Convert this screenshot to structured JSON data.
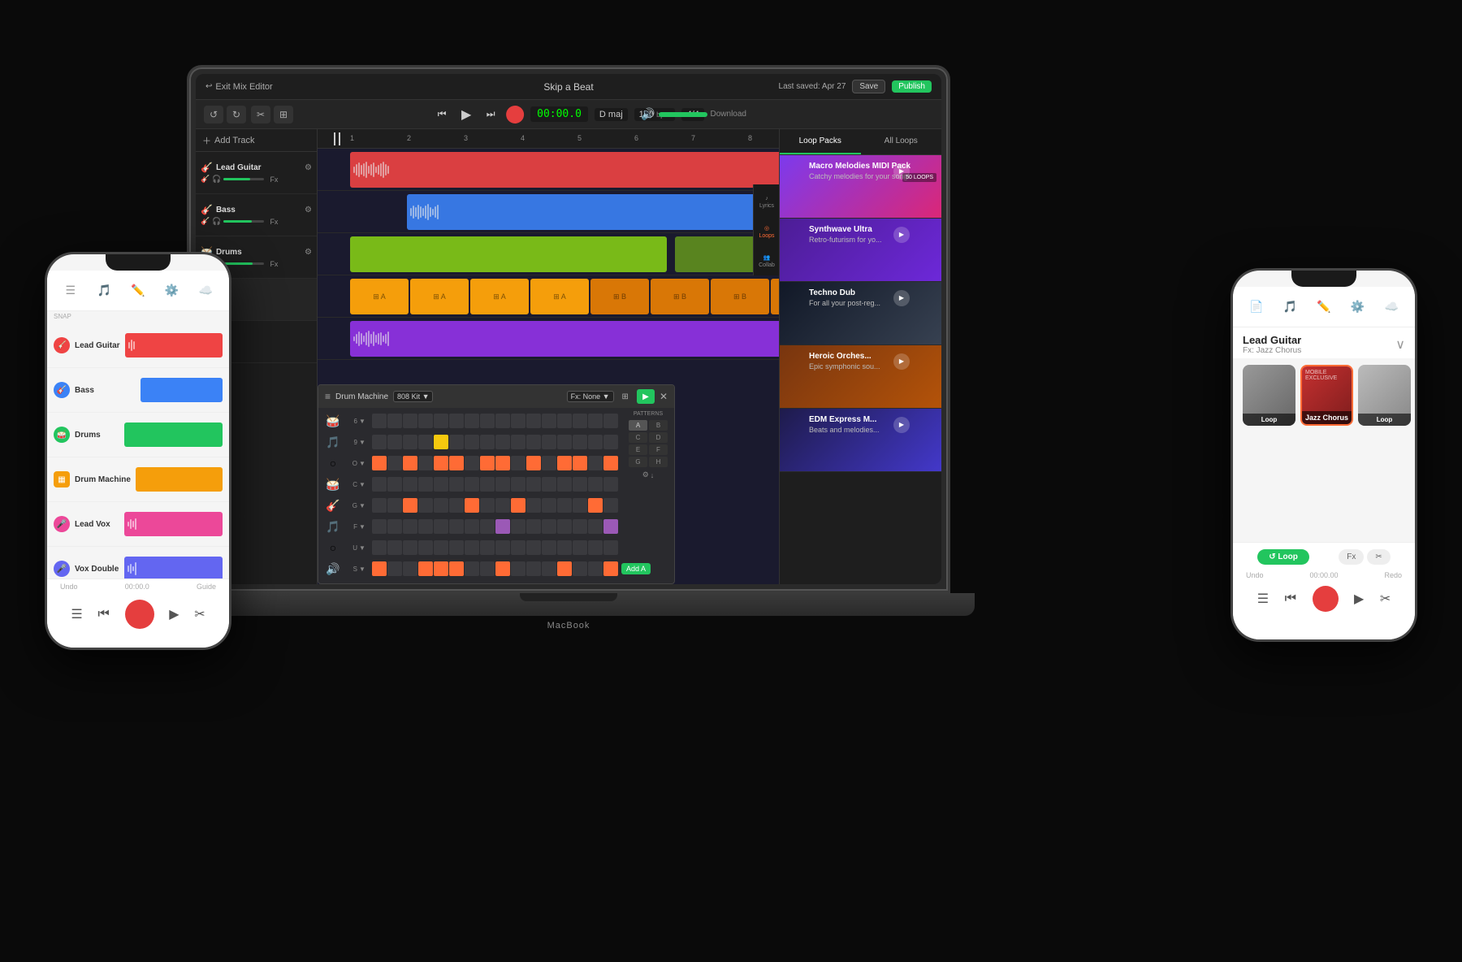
{
  "scene": {
    "background": "#0a0a0a"
  },
  "laptop": {
    "macbook_label": "MacBook",
    "daw": {
      "title": "Skip a Beat",
      "exit_label": "Exit Mix Editor",
      "last_saved": "Last saved: Apr 27",
      "save_label": "Save",
      "publish_label": "Publish",
      "download_label": "Download",
      "time": "00:00.0",
      "key": "D maj",
      "bpm": "120",
      "bpm_suffix": "bpm",
      "time_sig": "4/4",
      "tracks": [
        {
          "name": "Lead Guitar",
          "color": "#ef4444",
          "fx": "Fx"
        },
        {
          "name": "Bass",
          "color": "#3b82f6",
          "fx": "Fx"
        },
        {
          "name": "Drums",
          "color": "#84cc16",
          "fx": "Fx"
        },
        {
          "name": "Drum Machine",
          "color": "#f59e0b",
          "fx": "Fx"
        },
        {
          "name": "Lead Vox",
          "color": "#ec4899",
          "fx": "Fx"
        }
      ],
      "sidenav": [
        {
          "icon": "♪",
          "label": "Lyrics"
        },
        {
          "icon": "◎",
          "label": "Loops"
        },
        {
          "icon": "👥",
          "label": "Collab"
        }
      ],
      "loops_panel": {
        "tab1": "Loop Packs",
        "tab2": "All Loops",
        "items": [
          {
            "title": "Macro Melodies MIDI Pack",
            "sub": "Catchy melodies for your song!",
            "count": "50 LOOPS",
            "bg": "#9333ea"
          },
          {
            "title": "Synthwave Ultra",
            "sub": "Retro-futurism for yo...",
            "count": "",
            "bg": "#7c3aed"
          },
          {
            "title": "Techno Dub",
            "sub": "For all your post-reg...",
            "count": "",
            "bg": "#1f2937"
          },
          {
            "title": "Heroic Orches...",
            "sub": "Epic symphonic sou...",
            "count": "",
            "bg": "#92400e"
          },
          {
            "title": "EDM Express M...",
            "sub": "Beats and melodies...",
            "count": "",
            "bg": "#312e81"
          }
        ]
      },
      "drum_machine": {
        "title": "Drum Machine",
        "kit": "808 Kit",
        "fx": "Fx: None",
        "rows": [
          {
            "icon": "🥁",
            "num": "6",
            "color": "orange"
          },
          {
            "icon": "🎵",
            "num": "9",
            "color": "orange"
          },
          {
            "icon": "○",
            "num": "O",
            "color": "red"
          },
          {
            "icon": "🥁",
            "num": "C",
            "color": "orange"
          },
          {
            "icon": "🎸",
            "num": "G",
            "color": "orange"
          },
          {
            "icon": "🎵",
            "num": "F",
            "color": "orange"
          },
          {
            "icon": "○",
            "num": "U",
            "color": "purple"
          },
          {
            "icon": "🔊",
            "num": "S",
            "color": "orange"
          }
        ],
        "patterns_label": "PATTERNS",
        "patterns": [
          "A",
          "B",
          "C",
          "D",
          "E",
          "F",
          "G",
          "H"
        ],
        "add_label": "Add A"
      }
    }
  },
  "phone_left": {
    "time": "00:00.0",
    "snap_label": "SNAP",
    "undo_label": "Undo",
    "redo_label": "Guide",
    "tracks": [
      {
        "name": "Lead Guitar",
        "color": "#ef4444",
        "icon": "🎸"
      },
      {
        "name": "Bass",
        "color": "#3b82f6",
        "icon": "🎸"
      },
      {
        "name": "Drums",
        "color": "#22c55e",
        "icon": "🥁"
      },
      {
        "name": "Drum Machine",
        "color": "#f59e0b",
        "icon": "▦"
      },
      {
        "name": "Lead Vox",
        "color": "#ec4899",
        "icon": "🎤"
      },
      {
        "name": "Vox Double",
        "color": "#6366f1",
        "icon": "🎤"
      }
    ]
  },
  "phone_right": {
    "track_title": "Lead Guitar",
    "track_sub": "Fx: Jazz Chorus",
    "fx_tiles": [
      {
        "label": "Loop",
        "color": "#888"
      },
      {
        "label": "Jazz Chorus",
        "color": "#c53030"
      },
      {
        "label": "Loop",
        "color": "#aaa"
      }
    ],
    "undo_label": "Undo",
    "redo_label": "Redo",
    "time": "00:00.00",
    "nav_icons": [
      "📄",
      "🎵",
      "✏️",
      "⚙️",
      "☁️"
    ]
  }
}
